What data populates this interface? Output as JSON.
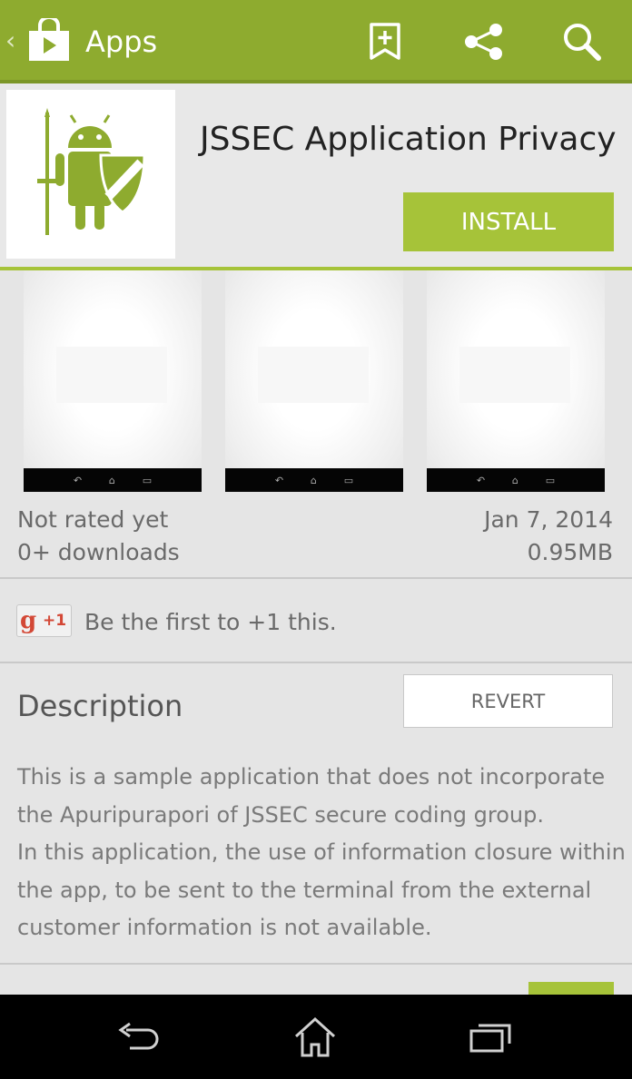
{
  "action_bar": {
    "title": "Apps",
    "up_caret": "‹",
    "actions": [
      "bookmark-add-icon",
      "share-icon",
      "search-icon"
    ],
    "color": "#8eab2f"
  },
  "app": {
    "title": "JSSEC Application Privacy",
    "install_label": "INSTALL",
    "accent": "#a6c339"
  },
  "screenshots": [
    "screenshot-1",
    "screenshot-2",
    "screenshot-3"
  ],
  "meta": {
    "rating": "Not rated yet",
    "downloads": "0+ downloads",
    "date": "Jan 7, 2014",
    "size": "0.95MB"
  },
  "plus_one": {
    "badge_g": "g",
    "badge_plus": "+1",
    "text": "Be the first to +1 this."
  },
  "description": {
    "heading": "Description",
    "revert_label": "REVERT",
    "para1": "This is a sample application that does not incorporate the Apuripurapori of JSSEC secure coding group.",
    "para2": "In this application, the use of information closure within the app, to be sent to the terminal from the external customer information is not available."
  },
  "nav_bar": [
    "back-icon",
    "home-icon",
    "recents-icon"
  ]
}
